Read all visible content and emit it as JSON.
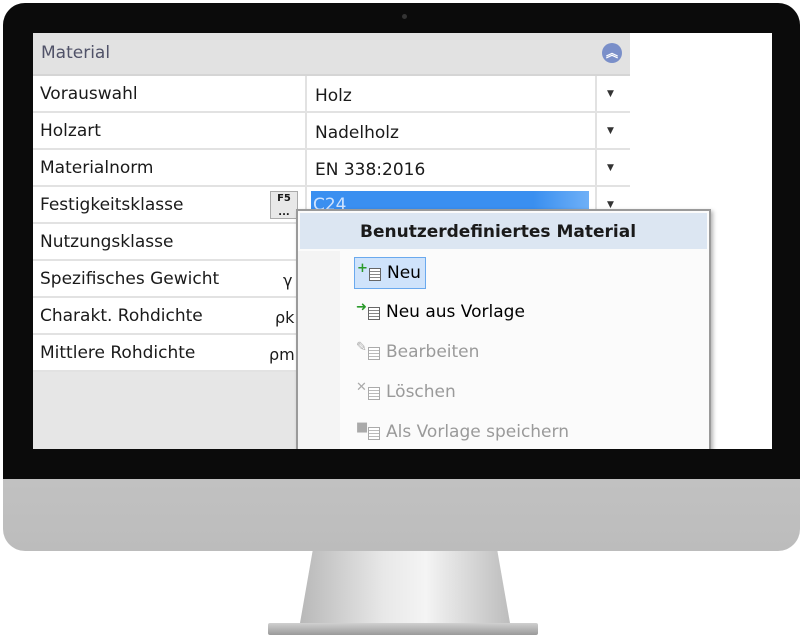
{
  "panel": {
    "title": "Material",
    "collapse_icon": "double-chevron-up-icon"
  },
  "rows": [
    {
      "label": "Vorauswahl",
      "value": "Holz"
    },
    {
      "label": "Holzart",
      "value": "Nadelholz"
    },
    {
      "label": "Materialnorm",
      "value": "EN 338:2016"
    },
    {
      "label": "Festigkeitsklasse",
      "value": "C24",
      "button": "F5"
    },
    {
      "label": "Nutzungsklasse"
    },
    {
      "label": "Spezifisches Gewicht",
      "symbol": "γ"
    },
    {
      "label": "Charakt. Rohdichte",
      "symbol": "ρk"
    },
    {
      "label": "Mittlere Rohdichte",
      "symbol": "ρm"
    }
  ],
  "menu": {
    "title": "Benutzerdefiniertes Material",
    "items": [
      {
        "label": "Neu",
        "state": "active"
      },
      {
        "label": "Neu aus Vorlage",
        "state": "enabled"
      },
      {
        "label": "Bearbeiten",
        "state": "disabled"
      },
      {
        "label": "Löschen",
        "state": "disabled"
      },
      {
        "label": "Als Vorlage speichern",
        "state": "disabled"
      }
    ]
  }
}
